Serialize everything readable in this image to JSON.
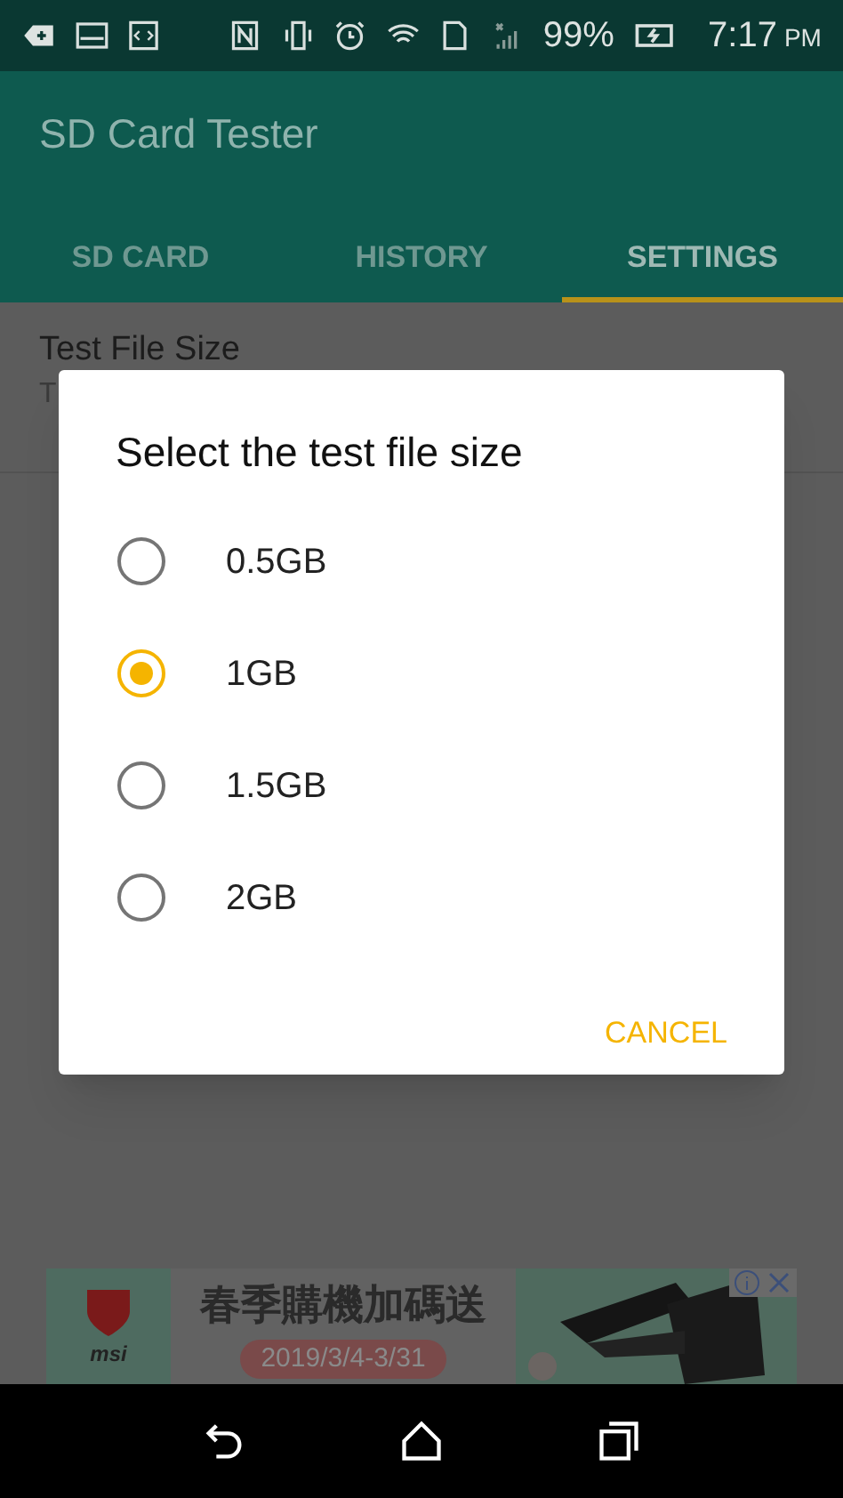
{
  "status_bar": {
    "battery": "99%",
    "time": "7:17",
    "meridiem": "PM"
  },
  "app_bar": {
    "title": "SD Card Tester"
  },
  "tabs": [
    {
      "label": "SD CARD",
      "selected": false
    },
    {
      "label": "HISTORY",
      "selected": false
    },
    {
      "label": "SETTINGS",
      "selected": true
    }
  ],
  "settings": {
    "title": "Test File Size",
    "summary": "T"
  },
  "dialog": {
    "title": "Select the test file size",
    "options": [
      {
        "label": "0.5GB",
        "selected": false
      },
      {
        "label": "1GB",
        "selected": true
      },
      {
        "label": "1.5GB",
        "selected": false
      },
      {
        "label": "2GB",
        "selected": false
      }
    ],
    "buttons": [
      "CANCEL"
    ]
  },
  "ad": {
    "brand": "msi",
    "headline": "春季購機加碼送",
    "dates": "2019/3/4-3/31"
  }
}
